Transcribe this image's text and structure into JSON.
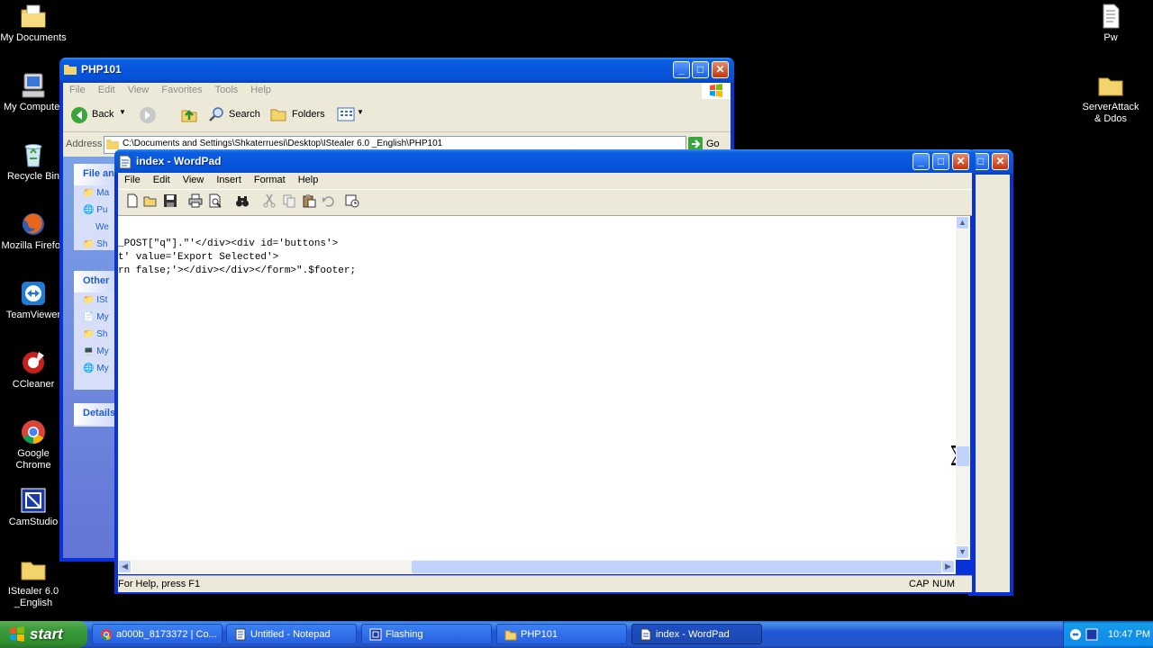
{
  "desktop": {
    "icons_left": [
      "My Documents",
      "My Computer",
      "Recycle Bin",
      "Mozilla Firefox",
      "TeamViewer",
      "CCleaner",
      "Google Chrome",
      "CamStudio",
      "IStealer 6.0 _English"
    ],
    "icons_right": [
      "Pw",
      "ServerAttack & Ddos"
    ]
  },
  "explorer": {
    "title": "PHP101",
    "menu": [
      "File",
      "Edit",
      "View",
      "Favorites",
      "Tools",
      "Help"
    ],
    "toolbar": {
      "back": "Back",
      "search": "Search",
      "folders": "Folders"
    },
    "address_label": "Address",
    "address_value": "C:\\Documents and Settings\\Shkaterruesi\\Desktop\\IStealer 6.0 _English\\PHP101",
    "go_label": "Go",
    "panels": {
      "file_tasks": {
        "header": "File an",
        "items": [
          "Ma",
          "Pu",
          "We",
          "Sh"
        ]
      },
      "other_places": {
        "header": "Other",
        "items": [
          "ISt",
          "My",
          "Sh",
          "My",
          "My"
        ]
      },
      "details": {
        "header": "Details"
      }
    }
  },
  "wordpad": {
    "title": "index - WordPad",
    "menu": [
      "File",
      "Edit",
      "View",
      "Insert",
      "Format",
      "Help"
    ],
    "lines": [
      "_POST[\"q\"].\"'</div><div id='buttons'>",
      "t' value='Export Selected'>",
      "rn false;'></div></div></form>\".$footer;"
    ],
    "status_text": "For Help, press F1",
    "status_caps": "CAP",
    "status_num": "NUM"
  },
  "taskbar": {
    "start_label": "start",
    "items": [
      "a000b_8173372 | Co...",
      "Untitled - Notepad",
      "Flashing",
      "PHP101",
      "index - WordPad"
    ],
    "clock": "10:47 PM"
  }
}
